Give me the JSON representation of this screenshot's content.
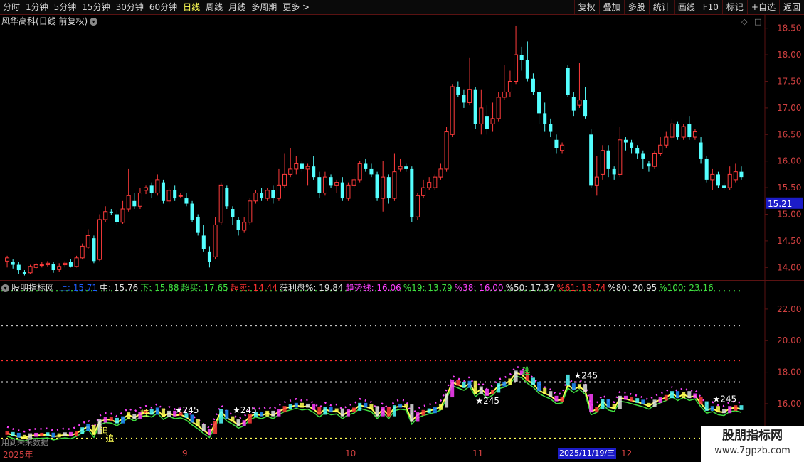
{
  "toolbar": {
    "periods": [
      "分时",
      "1分钟",
      "5分钟",
      "15分钟",
      "30分钟",
      "60分钟",
      "日线",
      "周线",
      "月线",
      "多周期",
      "更多 >"
    ],
    "active_period": "日线",
    "actions": [
      "复权",
      "叠加",
      "多股",
      "统计",
      "画线",
      "F10",
      "标记",
      "+自选",
      "返回"
    ]
  },
  "stock": {
    "title": "风华高科(日线 前复权)",
    "expand_icon": "chevron-down-icon"
  },
  "price_axis": {
    "ticks": [
      "18.50",
      "18.00",
      "17.50",
      "17.00",
      "16.50",
      "16.00",
      "15.50",
      "15.00",
      "14.50",
      "14.00"
    ],
    "last_price": "15.21",
    "range": [
      13.75,
      18.75
    ]
  },
  "indicator": {
    "name": "股朋指标网",
    "values": [
      {
        "label": "上:",
        "value": "15.71",
        "color": "#1e5cff"
      },
      {
        "label": "中:",
        "value": "15.76",
        "color": "#e0e0e0"
      },
      {
        "label": "下:",
        "value": "15.88",
        "color": "#40e040"
      },
      {
        "label": "超买:",
        "value": "17.65",
        "color": "#40e040"
      },
      {
        "label": "超卖:",
        "value": "14.44",
        "color": "#ff3030"
      },
      {
        "label": "获利盘%:",
        "value": "19.84",
        "color": "#e0e0e0"
      },
      {
        "label": "趋势线:",
        "value": "16.06",
        "color": "#ff40ff"
      },
      {
        "label": "%19:",
        "value": "13.79",
        "color": "#40e040"
      },
      {
        "label": "%38:",
        "value": "16.00",
        "color": "#ff40ff"
      },
      {
        "label": "%50:",
        "value": "17.37",
        "color": "#e0e0e0"
      },
      {
        "label": "%61:",
        "value": "18.74",
        "color": "#ff3030"
      },
      {
        "label": "%80:",
        "value": "20.95",
        "color": "#e0e0e0"
      },
      {
        "label": "%100:",
        "value": "23.16",
        "color": "#40e040"
      }
    ],
    "axis_ticks": [
      "22.00",
      "20.00",
      "18.00",
      "16.00"
    ],
    "range": [
      13.2,
      23.8
    ],
    "signals": [
      "追",
      "桩",
      "逃",
      "★245"
    ]
  },
  "time_axis": {
    "labels": [
      "2025年",
      "9",
      "10",
      "11",
      "12"
    ],
    "selected_date": "2025/11/19/三"
  },
  "future_text": "用到未来数据",
  "watermark": {
    "title": "股朋指标网",
    "url": "www.7gpzb.com"
  },
  "colors": {
    "up": "#ff3b3b",
    "down": "#54ffff",
    "grid": "#5a1212",
    "axis_text": "#d04040"
  },
  "chart_data": {
    "type": "candlestick",
    "candles": [
      [
        14.12,
        14.18,
        14.22,
        14.0
      ],
      [
        14.1,
        14.05,
        14.15,
        13.98
      ],
      [
        14.05,
        13.95,
        14.1,
        13.88
      ],
      [
        13.92,
        13.88,
        13.95,
        13.85
      ],
      [
        13.9,
        14.02,
        14.05,
        13.88
      ],
      [
        14.0,
        14.05,
        14.08,
        13.98
      ],
      [
        14.04,
        14.05,
        14.1,
        14.0
      ],
      [
        14.05,
        14.08,
        14.12,
        14.02
      ],
      [
        14.06,
        13.95,
        14.1,
        13.9
      ],
      [
        13.96,
        14.02,
        14.08,
        13.92
      ],
      [
        14.05,
        14.08,
        14.12,
        14.0
      ],
      [
        14.1,
        14.02,
        14.15,
        14.0
      ],
      [
        14.02,
        14.18,
        14.22,
        14.0
      ],
      [
        14.18,
        14.4,
        14.45,
        14.15
      ],
      [
        14.38,
        14.6,
        14.72,
        14.35
      ],
      [
        14.55,
        14.12,
        14.6,
        14.08
      ],
      [
        14.15,
        14.9,
        15.0,
        14.12
      ],
      [
        14.9,
        15.05,
        15.15,
        14.85
      ],
      [
        15.05,
        15.02,
        15.1,
        14.98
      ],
      [
        15.0,
        14.85,
        15.08,
        14.8
      ],
      [
        14.85,
        15.1,
        15.25,
        14.82
      ],
      [
        15.1,
        15.35,
        15.85,
        15.05
      ],
      [
        15.25,
        15.15,
        15.4,
        15.1
      ],
      [
        15.15,
        15.4,
        15.5,
        15.1
      ],
      [
        15.45,
        15.5,
        15.55,
        15.38
      ],
      [
        15.55,
        15.4,
        15.6,
        15.3
      ],
      [
        15.4,
        15.65,
        15.75,
        15.35
      ],
      [
        15.6,
        15.25,
        15.65,
        15.2
      ],
      [
        15.25,
        15.45,
        15.5,
        15.2
      ],
      [
        15.45,
        15.3,
        15.55,
        15.25
      ],
      [
        15.35,
        15.35,
        15.4,
        15.3
      ],
      [
        15.3,
        15.2,
        15.4,
        15.15
      ],
      [
        15.2,
        14.9,
        15.25,
        14.85
      ],
      [
        14.95,
        14.65,
        15.0,
        14.6
      ],
      [
        14.6,
        14.35,
        14.8,
        14.3
      ],
      [
        14.3,
        14.1,
        14.4,
        14.0
      ],
      [
        14.2,
        14.8,
        14.95,
        14.15
      ],
      [
        14.85,
        15.55,
        15.6,
        14.8
      ],
      [
        15.5,
        15.15,
        15.55,
        15.1
      ],
      [
        15.1,
        14.95,
        15.15,
        14.8
      ],
      [
        14.9,
        14.7,
        14.95,
        14.6
      ],
      [
        14.7,
        14.85,
        14.95,
        14.65
      ],
      [
        14.85,
        15.25,
        15.3,
        14.8
      ],
      [
        15.25,
        15.4,
        15.45,
        15.2
      ],
      [
        15.4,
        15.3,
        15.5,
        15.25
      ],
      [
        15.3,
        15.45,
        15.5,
        15.25
      ],
      [
        15.45,
        15.3,
        15.55,
        15.2
      ],
      [
        15.3,
        15.55,
        15.85,
        15.25
      ],
      [
        15.55,
        15.75,
        16.15,
        15.5
      ],
      [
        15.75,
        15.85,
        16.25,
        15.7
      ],
      [
        15.85,
        15.95,
        16.1,
        15.75
      ],
      [
        15.95,
        15.85,
        16.0,
        15.8
      ],
      [
        15.85,
        15.9,
        15.95,
        15.55
      ],
      [
        15.9,
        15.7,
        16.1,
        15.65
      ],
      [
        15.7,
        15.4,
        15.8,
        15.3
      ],
      [
        15.4,
        15.7,
        15.8,
        15.35
      ],
      [
        15.7,
        15.55,
        15.75,
        15.5
      ],
      [
        15.55,
        15.6,
        15.65,
        15.4
      ],
      [
        15.6,
        15.3,
        15.7,
        15.25
      ],
      [
        15.3,
        15.55,
        15.6,
        15.25
      ],
      [
        15.55,
        15.65,
        15.7,
        15.5
      ],
      [
        15.65,
        15.95,
        16.0,
        15.6
      ],
      [
        15.95,
        15.85,
        16.05,
        15.8
      ],
      [
        15.85,
        15.75,
        15.95,
        15.7
      ],
      [
        15.75,
        15.3,
        15.8,
        15.25
      ],
      [
        15.3,
        15.7,
        16.0,
        15.05
      ],
      [
        15.7,
        15.3,
        15.75,
        15.2
      ],
      [
        15.3,
        15.8,
        16.15,
        15.25
      ],
      [
        15.85,
        15.9,
        16.05,
        15.8
      ],
      [
        15.9,
        15.85,
        15.95,
        15.8
      ],
      [
        15.85,
        14.95,
        15.9,
        14.85
      ],
      [
        14.95,
        15.35,
        15.4,
        14.9
      ],
      [
        15.35,
        15.5,
        15.65,
        15.3
      ],
      [
        15.5,
        15.6,
        15.7,
        15.45
      ],
      [
        15.5,
        15.7,
        15.75,
        15.45
      ],
      [
        15.7,
        15.85,
        15.95,
        15.65
      ],
      [
        15.85,
        16.55,
        16.65,
        15.8
      ],
      [
        16.5,
        17.4,
        17.45,
        16.45
      ],
      [
        17.4,
        17.25,
        17.5,
        17.2
      ],
      [
        17.25,
        17.1,
        17.35,
        17.0
      ],
      [
        17.1,
        17.35,
        17.95,
        17.05
      ],
      [
        17.35,
        16.7,
        17.4,
        16.6
      ],
      [
        16.7,
        17.0,
        17.35,
        16.5
      ],
      [
        16.85,
        16.6,
        17.05,
        16.5
      ],
      [
        16.7,
        16.8,
        17.1,
        16.55
      ],
      [
        16.8,
        17.2,
        17.3,
        16.75
      ],
      [
        17.2,
        17.3,
        17.8,
        17.15
      ],
      [
        17.3,
        17.5,
        17.7,
        17.2
      ],
      [
        17.5,
        18.0,
        18.55,
        17.45
      ],
      [
        18.0,
        17.9,
        18.15,
        17.7
      ],
      [
        17.9,
        17.55,
        18.25,
        17.5
      ],
      [
        17.55,
        17.3,
        17.65,
        17.25
      ],
      [
        17.3,
        16.9,
        17.35,
        16.7
      ],
      [
        16.9,
        16.7,
        17.1,
        16.55
      ],
      [
        16.7,
        16.55,
        16.8,
        16.45
      ],
      [
        16.4,
        16.25,
        16.5,
        16.15
      ],
      [
        16.2,
        16.3,
        16.35,
        16.15
      ],
      [
        17.75,
        17.25,
        17.8,
        17.2
      ],
      [
        17.2,
        16.95,
        17.3,
        16.85
      ],
      [
        17.05,
        17.15,
        17.85,
        17.0
      ],
      [
        17.15,
        16.85,
        17.4,
        16.8
      ],
      [
        16.5,
        15.55,
        16.6,
        15.5
      ],
      [
        15.55,
        15.7,
        16.1,
        15.35
      ],
      [
        15.75,
        16.2,
        16.3,
        15.65
      ],
      [
        16.2,
        15.85,
        16.3,
        15.7
      ],
      [
        15.85,
        15.75,
        15.9,
        15.65
      ],
      [
        15.75,
        16.4,
        16.65,
        15.7
      ],
      [
        16.4,
        16.35,
        16.45,
        16.2
      ],
      [
        16.35,
        16.25,
        16.4,
        16.15
      ],
      [
        16.25,
        16.15,
        16.3,
        16.05
      ],
      [
        16.15,
        16.05,
        16.2,
        15.85
      ],
      [
        15.95,
        15.9,
        16.0,
        15.8
      ],
      [
        15.9,
        16.15,
        16.2,
        15.85
      ],
      [
        16.15,
        16.3,
        16.45,
        16.1
      ],
      [
        16.3,
        16.45,
        16.55,
        16.25
      ],
      [
        16.45,
        16.7,
        16.8,
        16.4
      ],
      [
        16.7,
        16.45,
        16.75,
        16.4
      ],
      [
        16.45,
        16.65,
        16.7,
        16.4
      ],
      [
        16.7,
        16.45,
        16.85,
        16.4
      ],
      [
        16.45,
        16.55,
        16.6,
        16.4
      ],
      [
        16.35,
        16.05,
        16.45,
        15.95
      ],
      [
        16.05,
        15.65,
        16.1,
        15.6
      ],
      [
        15.65,
        15.75,
        15.85,
        15.45
      ],
      [
        15.75,
        15.55,
        15.8,
        15.5
      ],
      [
        15.55,
        15.5,
        15.6,
        15.45
      ],
      [
        15.5,
        15.75,
        15.9,
        15.45
      ],
      [
        15.65,
        15.8,
        15.95,
        15.6
      ],
      [
        15.8,
        15.7,
        15.9,
        15.65
      ]
    ]
  }
}
